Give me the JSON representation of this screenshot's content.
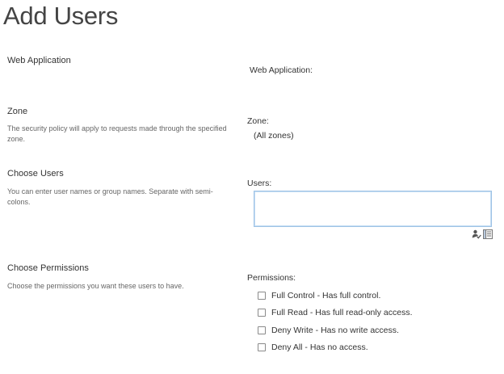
{
  "page": {
    "title": "Add Users"
  },
  "sections": {
    "web_application": {
      "title": "Web Application"
    },
    "zone": {
      "title": "Zone",
      "description": "The security policy will apply to requests made through the specified zone."
    },
    "choose_users": {
      "title": "Choose Users",
      "description": "You can enter user names or group names. Separate with semi-colons."
    },
    "choose_permissions": {
      "title": "Choose Permissions",
      "description": "Choose the permissions you want these users to have."
    }
  },
  "fields": {
    "web_application": {
      "label": "Web Application:"
    },
    "zone": {
      "label": "Zone:",
      "value": "(All zones)"
    },
    "users": {
      "label": "Users:",
      "value": "",
      "check_names_icon": "person-check-icon",
      "browse_icon": "address-book-icon"
    },
    "permissions": {
      "label": "Permissions:",
      "options": [
        {
          "label": "Full Control - Has full control.",
          "checked": false
        },
        {
          "label": "Full Read - Has full read-only access.",
          "checked": false
        },
        {
          "label": "Deny Write - Has no write access.",
          "checked": false
        },
        {
          "label": "Deny All - Has no access.",
          "checked": false
        }
      ]
    }
  }
}
